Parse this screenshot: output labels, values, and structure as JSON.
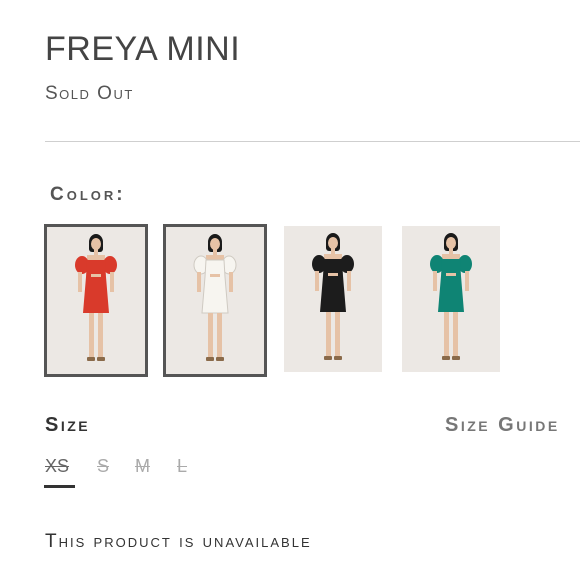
{
  "product": {
    "title": "FREYA MINI",
    "status": "Sold Out"
  },
  "color": {
    "label": "Color:",
    "swatches": [
      {
        "name": "red",
        "dress_color": "#d93a2b",
        "selected": true
      },
      {
        "name": "white",
        "dress_color": "#f7f5f0",
        "selected": true
      },
      {
        "name": "black",
        "dress_color": "#1c1c1c",
        "selected": false
      },
      {
        "name": "teal",
        "dress_color": "#0f8474",
        "selected": false
      }
    ]
  },
  "size": {
    "label": "Size",
    "guide_label": "Size Guide",
    "options": [
      "XS",
      "S",
      "M",
      "L"
    ],
    "selected": "XS"
  },
  "message": "This product is unavailable"
}
